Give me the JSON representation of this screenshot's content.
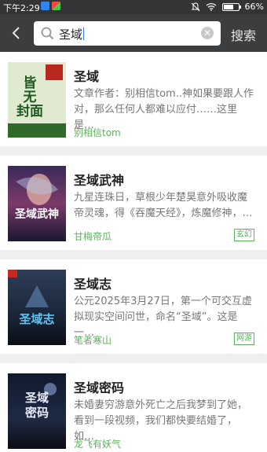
{
  "status_bar": {
    "time": "下午2:29",
    "battery": "66%",
    "battery_level": 0.66
  },
  "header": {
    "search_query": "圣域",
    "search_button": "搜索"
  },
  "results": [
    {
      "title": "圣域",
      "description": "文章作者：别相信tom..神如果要跟人作对，那么任何人都难以应付……这里是…",
      "author": "别相信tom",
      "tag": "",
      "cover_text": "皆无封面"
    },
    {
      "title": "圣域武神",
      "description": "九星连珠日，草根少年楚昊意外吸收魔帝灵魂，得《吞魔天经》，炼魔修神，…",
      "author": "甘梅帝瓜",
      "tag": "玄幻",
      "cover_text": "圣域武神"
    },
    {
      "title": "圣域志",
      "description": "公元2025年3月27日，第一个可交互虚拟现实空间问世，命名“圣域”。这是一…",
      "author": "笔者寒山",
      "tag": "网游",
      "cover_text": "圣域志"
    },
    {
      "title": "圣域密码",
      "description": "未婚妻穷游意外死亡之后我梦到了她，看到一段视频，我们都快要结婚了，如…",
      "author": "龙飞有妖气",
      "tag": "",
      "cover_text": "圣域密码"
    }
  ],
  "colors": {
    "status_bar": "#333435",
    "top_bar": "#3b3d3f",
    "author_green": "#5bb35b",
    "separator": "#efefef"
  }
}
